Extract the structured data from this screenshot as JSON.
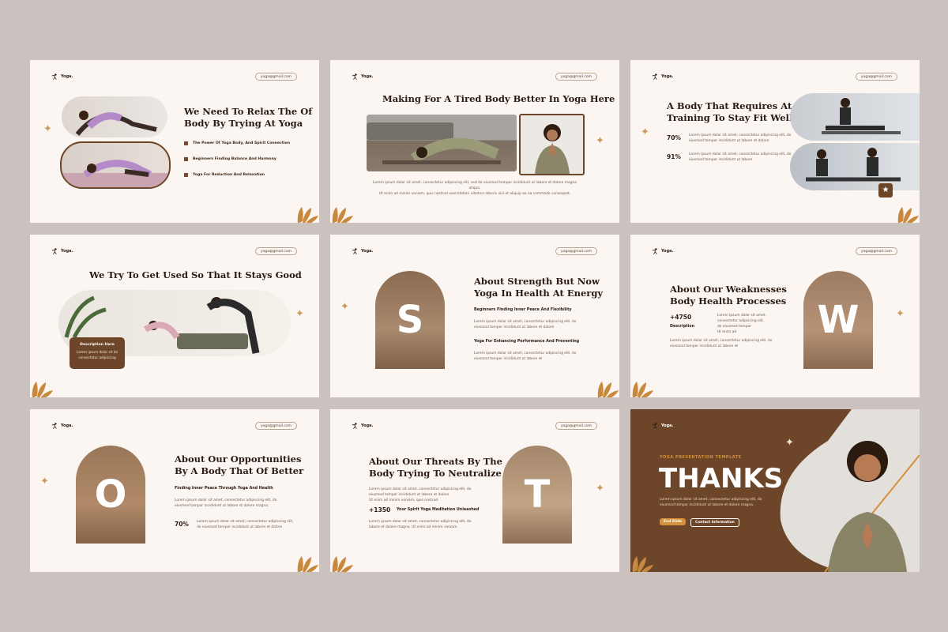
{
  "brand": {
    "name": "Yoga.",
    "email": "yoga@gmail.com"
  },
  "colors": {
    "background": "#cbc1bf",
    "slide": "#fbf6f1",
    "accent_brown": "#6d4528",
    "accent_orange": "#d4903a",
    "leaf": "#c8883e"
  },
  "lorem1": "Lorem ipsum dolor sit amet, consectetur adipiscing elit,",
  "lorem2": "eiusmod tempor incididunt ut labore et",
  "slides": {
    "s1": {
      "title1": "We Need To Relax The Of",
      "title2": "Body By Trying At Yoga",
      "bullets": [
        "The Power Of Yoga Body, And Spirit Connection",
        "Beginners Finding Balance And Harmony",
        "Yoga For Reduction And Relaxation"
      ]
    },
    "s2": {
      "title": "Making For A Tired Body Better In Yoga Here",
      "body1": "Lorem ipsum dolor sit amet, consectetur adipiscing elit, sed do eiusmod tempor incididunt ut labore et dolore magna aliqua.",
      "body2": "Ut enim ad minim veniam, quis nostrud exercitation ullamco laboris nisi ut aliquip ex ea commodo consequat."
    },
    "s3": {
      "title1": "A Body That Requires At",
      "title2": "Training To Stay Fit Well",
      "stat1": "70%",
      "stat2": "91%",
      "body1a": "Lorem ipsum dolor sit amet, consectetur adipiscing elit, do",
      "body1b": "eiusmod tempor incididunt ut labore et dolore",
      "body2a": "Lorem ipsum dolor sit amet, consectetur adipiscing elit, do",
      "body2b": "eiusmod tempor incididunt ut labore"
    },
    "s4": {
      "title": "We Try To Get Used So That It Stays Good",
      "card_title": "Description Here",
      "card_body1": "Lorem ipsum dolor sit do",
      "card_body2": "consectetur adipiscing"
    },
    "s5": {
      "letter": "S",
      "title1": "About Strength But Now",
      "title2": "Yoga In Health At Energy",
      "sub1": "Beginners Finding Inner Peace And Flexibility",
      "sub2": "Yoga For Enhancing Performance And Preventing",
      "body1a": "Lorem ipsum dolor sit amet, consectetur adipiscing elit, do",
      "body1b": "eiusmod tempor incididunt ut labore et dolore",
      "body2a": "Lorem ipsum dolor sit amet, consectetur adipiscing elit, do",
      "body2b": "eiusmod tempor incididunt ut labore et"
    },
    "s6": {
      "letter": "W",
      "title1": "About Our Weaknesses",
      "title2": "Body Health Processes",
      "stat": "+4750",
      "stat_label": "Description",
      "body1a": "Lorem ipsum dolor sit amet,",
      "body1b": "consectetur adipiscing elit,",
      "body1c": "do eiusmod tempor",
      "body1d": "Ut enim ad",
      "body2a": "Lorem ipsum dolor sit amet, consectetur adipiscing elit, do",
      "body2b": "eiusmod tempor incididunt ut labore et"
    },
    "s7": {
      "letter": "O",
      "title1": "About Our Opportunities",
      "title2": "By A Body That Of Better",
      "sub": "Finding Inner Peace Through Yoga And Health",
      "body1a": "Lorem ipsum dolor sit amet, consectetur adipiscing elit, do",
      "body1b": "eiusmod tempor incididunt ut labore et dolore magna.",
      "stat": "70%",
      "body2a": "Lorem ipsum dolor sit amet, consectetur adipiscing elit,",
      "body2b": "do eiusmod tempor incididunt ut labore et dolore"
    },
    "s8": {
      "letter": "T",
      "title1": "About Our Threats By The",
      "title2": "Body Trying To Neutralize",
      "body1a": "Lorem ipsum dolor sit amet, consectetur adipiscing elit, do",
      "body1b": "eiusmod tempor incididunt ut labore et dolore",
      "body1c": "Ut enim ad minim veniam, quis nostrud",
      "stat": "+1350",
      "stat_label": "Your Spirit Yoga Meditation Unleashed",
      "body2a": "Lorem ipsum dolor sit amet, consectetur adipiscing elit, do",
      "body2b": "labore et dolore magna. Ut enim ad minim veniam."
    },
    "s9": {
      "kicker": "YOGA PRESENTATION TEMPLATE",
      "title": "THANKS",
      "body1": "Lorem ipsum dolor sit amet, consectetur adipiscing elit, do",
      "body2": "eiusmod tempor incididunt ut labore et dolore magna.",
      "btn1": "End Slide",
      "btn2": "Contact Information"
    }
  }
}
